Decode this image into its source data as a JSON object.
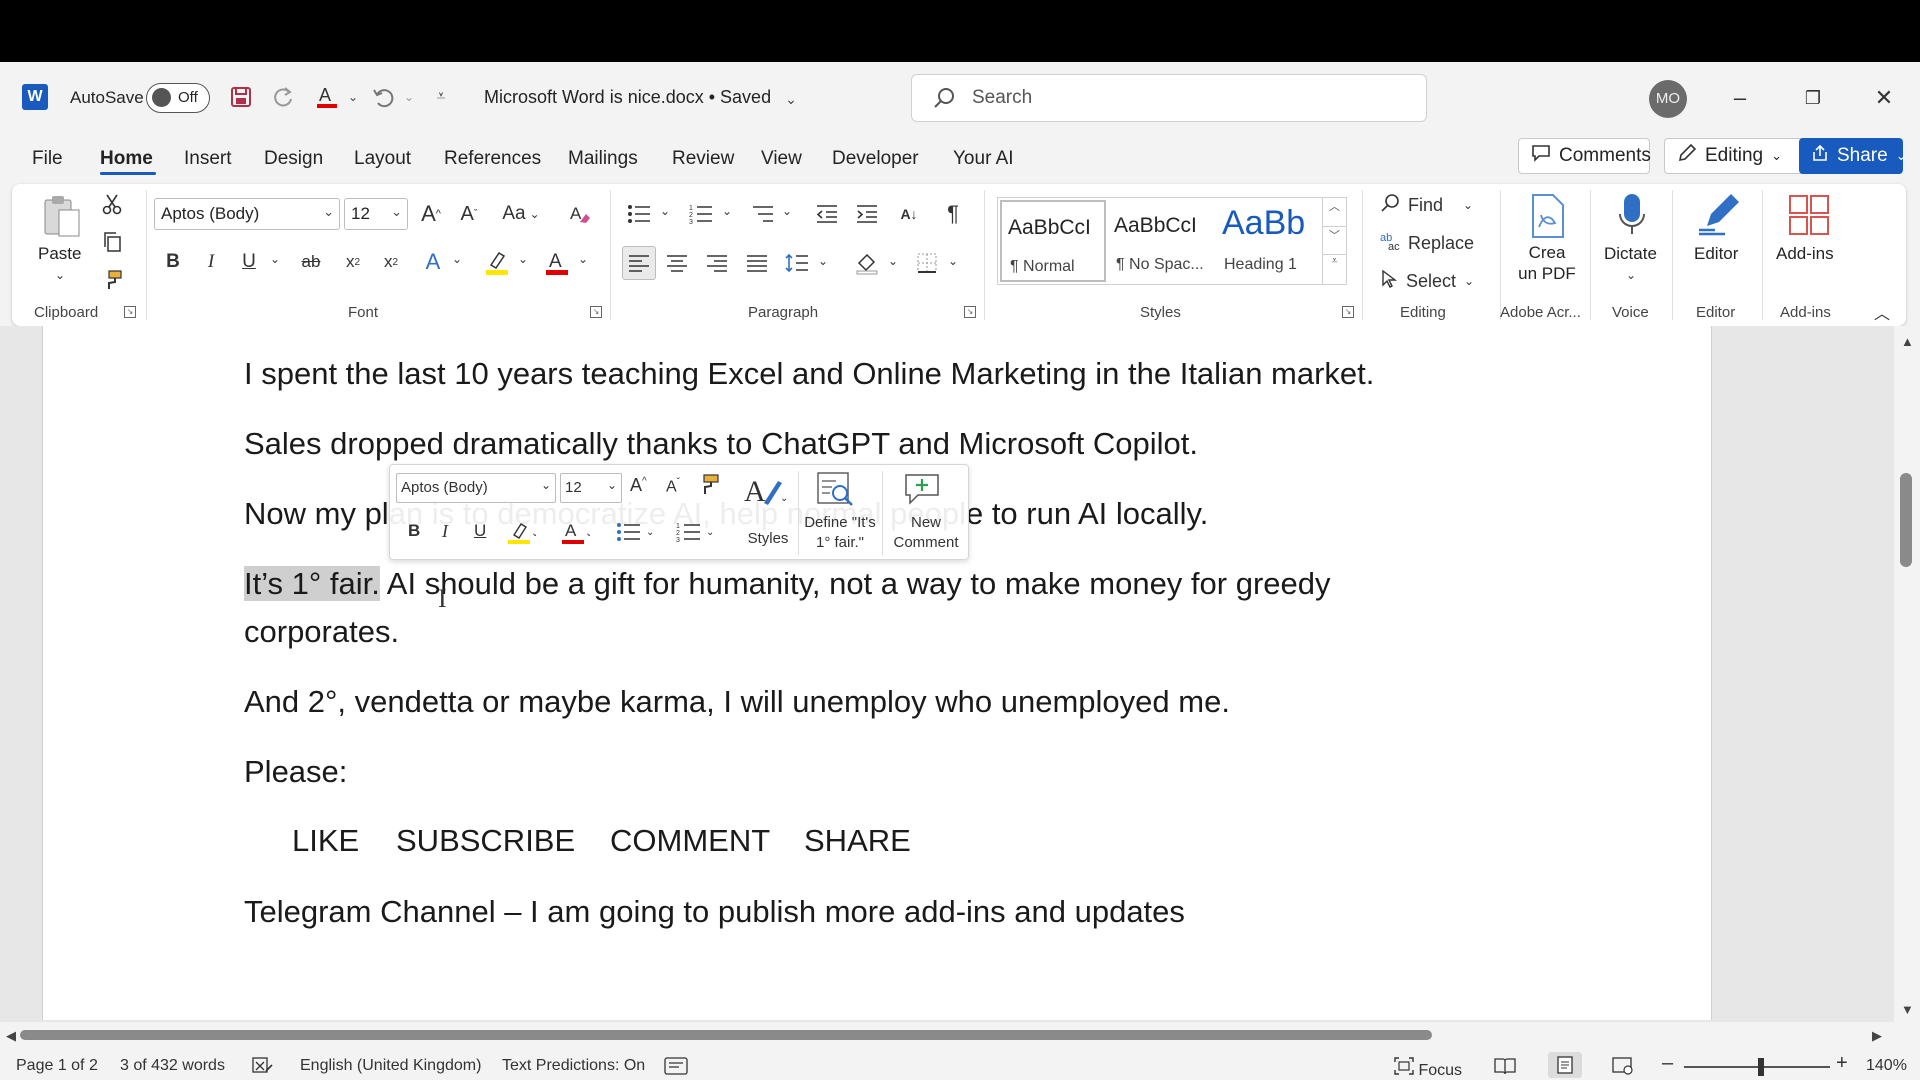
{
  "titlebar": {
    "autosave_label": "AutoSave",
    "autosave_state": "Off",
    "document_title": "Microsoft Word is nice.docx • Saved",
    "search_placeholder": "Search",
    "avatar_initials": "MO"
  },
  "tabs": [
    "File",
    "Home",
    "Insert",
    "Design",
    "Layout",
    "References",
    "Mailings",
    "Review",
    "View",
    "Developer",
    "Your AI"
  ],
  "active_tab": "Home",
  "header_actions": {
    "comments": "Comments",
    "editing": "Editing",
    "share": "Share"
  },
  "ribbon": {
    "clipboard": {
      "paste": "Paste",
      "label": "Clipboard"
    },
    "font": {
      "family": "Aptos (Body)",
      "size": "12",
      "label": "Font",
      "case_btn": "Aa"
    },
    "paragraph": {
      "label": "Paragraph"
    },
    "styles": {
      "label": "Styles",
      "tiles": [
        {
          "preview": "AaBbCcI",
          "name": "¶ Normal"
        },
        {
          "preview": "AaBbCcI",
          "name": "¶ No Spac..."
        },
        {
          "preview": "AaBb",
          "name": "Heading 1"
        }
      ]
    },
    "editing": {
      "find": "Find",
      "replace": "Replace",
      "select": "Select",
      "label": "Editing"
    },
    "adobe": {
      "btn_line1": "Crea",
      "btn_line2": "un PDF",
      "label": "Adobe Acr..."
    },
    "voice": {
      "btn": "Dictate",
      "label": "Voice"
    },
    "editor": {
      "btn": "Editor",
      "label": "Editor"
    },
    "addins": {
      "btn": "Add-ins",
      "label": "Add-ins"
    }
  },
  "document": {
    "p1": "I spent the last 10 years teaching Excel and Online Marketing in the Italian market.",
    "p2": "Sales dropped dramatically thanks to ChatGPT and Microsoft Copilot.",
    "p3": "Now my plan is to democratize AI, help normal people to run AI locally.",
    "p4_selected": "It’s 1° fair.",
    "p4_rest": " AI should be a gift for humanity, not a way to make money for greedy",
    "p4_line2": "corporates.",
    "p5": "And 2°, vendetta or maybe karma, I will unemploy who unemployed me.",
    "p6": "Please:",
    "cta": [
      "LIKE",
      "SUBSCRIBE",
      "COMMENT",
      "SHARE"
    ],
    "p7": "Telegram Channel – I am going to publish more add-ins and updates"
  },
  "mini_toolbar": {
    "font": "Aptos (Body)",
    "size": "12",
    "styles": "Styles",
    "define_line1": "Define \"It's",
    "define_line2": "1° fair.\"",
    "comment_line1": "New",
    "comment_line2": "Comment"
  },
  "statusbar": {
    "page": "Page 1 of 2",
    "words": "3 of 432 words",
    "language": "English (United Kingdom)",
    "predictions": "Text Predictions: On",
    "focus": "Focus",
    "zoom": "140%"
  },
  "colors": {
    "accent": "#185abd",
    "font_color_red": "#e00000",
    "highlight_yellow": "#ffe600"
  }
}
